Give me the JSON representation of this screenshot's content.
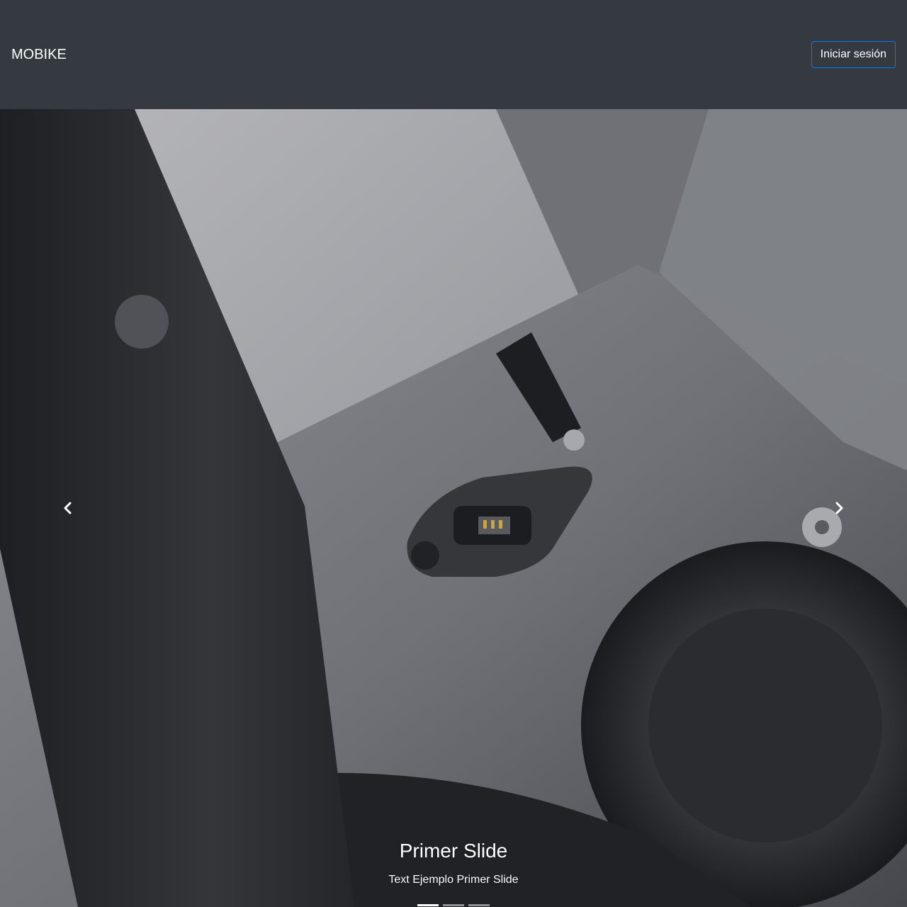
{
  "navbar": {
    "brand": "MOBIKE",
    "login_label": "Iniciar sesión",
    "background_color": "#343a40",
    "login_border_color": "#007bff"
  },
  "carousel": {
    "image_icon": "bicycle-frame-charging-port-photo",
    "active_slide": 1,
    "slide_count": 3,
    "slides": [
      {
        "title": "Primer Slide",
        "text": "Text Ejemplo Primer Slide"
      }
    ],
    "prev_icon": "chevron-left-icon",
    "next_icon": "chevron-right-icon"
  }
}
